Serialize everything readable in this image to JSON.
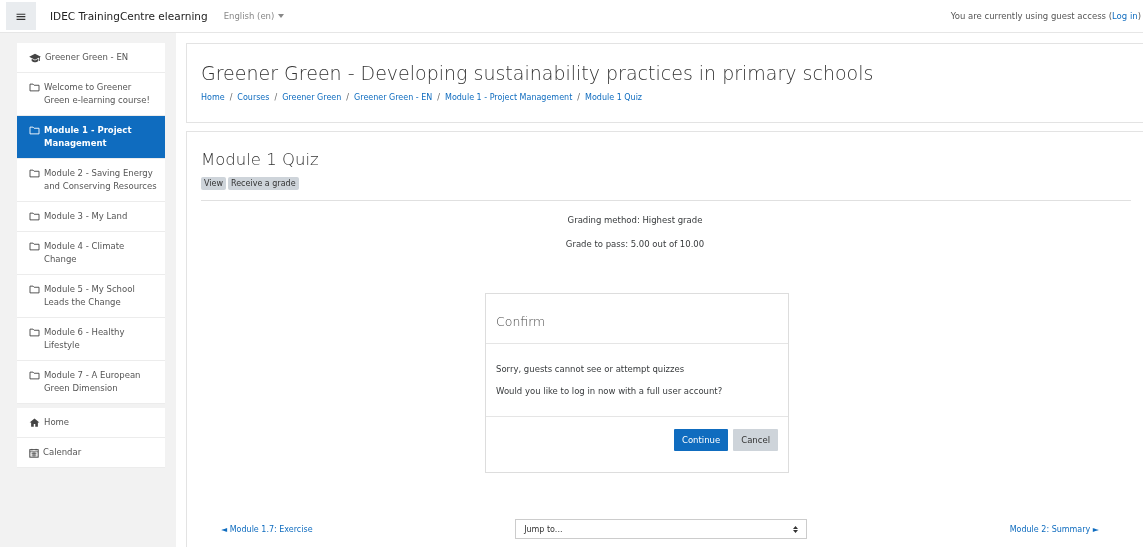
{
  "navbar": {
    "menu_icon": "≡",
    "site_name": "IDEC TrainingCentre elearning",
    "language": "English (en)",
    "guest_notice": "You are currently using guest access (",
    "login_link": "Log in",
    "guest_notice_end": ")"
  },
  "sidebar": {
    "sections": [
      {
        "items": [
          {
            "kind": "course",
            "label": "Greener Green - EN",
            "selected": false
          },
          {
            "kind": "folder",
            "label": "Welcome to Greener Green e-learning course!",
            "selected": false
          },
          {
            "kind": "folder",
            "label": "Module 1 - Project Management",
            "selected": true
          },
          {
            "kind": "folder",
            "label": "Module 2 - Saving Energy and Conserving Resources",
            "selected": false
          },
          {
            "kind": "folder",
            "label": "Module 3 - My Land",
            "selected": false
          },
          {
            "kind": "folder",
            "label": "Module 4 - Climate Change",
            "selected": false
          },
          {
            "kind": "folder",
            "label": "Module 5 - My School Leads the Change",
            "selected": false
          },
          {
            "kind": "folder",
            "label": "Module 6 - Healthy Lifestyle",
            "selected": false
          },
          {
            "kind": "folder",
            "label": "Module 7 - A European Green Dimension",
            "selected": false
          }
        ]
      },
      {
        "items": [
          {
            "kind": "home",
            "label": "Home",
            "selected": false
          },
          {
            "kind": "calendar",
            "label": "Calendar",
            "selected": false
          }
        ]
      }
    ]
  },
  "header": {
    "title": "Greener Green - Developing sustainability practices in primary schools",
    "breadcrumb_separator": "/",
    "breadcrumbs": [
      "Home",
      "Courses",
      "Greener Green",
      "Greener Green - EN",
      "Module 1 - Project Management",
      "Module 1 Quiz"
    ]
  },
  "activity": {
    "title": "Module 1 Quiz",
    "badges": [
      "View",
      "Receive a grade"
    ],
    "info": [
      "Grading method: Highest grade",
      "Grade to pass: 5.00 out of 10.00"
    ]
  },
  "dialog": {
    "title": "Confirm",
    "messages": [
      "Sorry, guests cannot see or attempt quizzes",
      "Would you like to log in now with a full user account?"
    ],
    "buttons": [
      {
        "label": "Continue",
        "kind": "primary"
      },
      {
        "label": "Cancel",
        "kind": "secondary"
      }
    ]
  },
  "footer_nav": {
    "previous": "◄ Module 1.7: Exercise",
    "jump": {
      "value": "Jump to..."
    },
    "next": "Module 2: Summary ►"
  }
}
